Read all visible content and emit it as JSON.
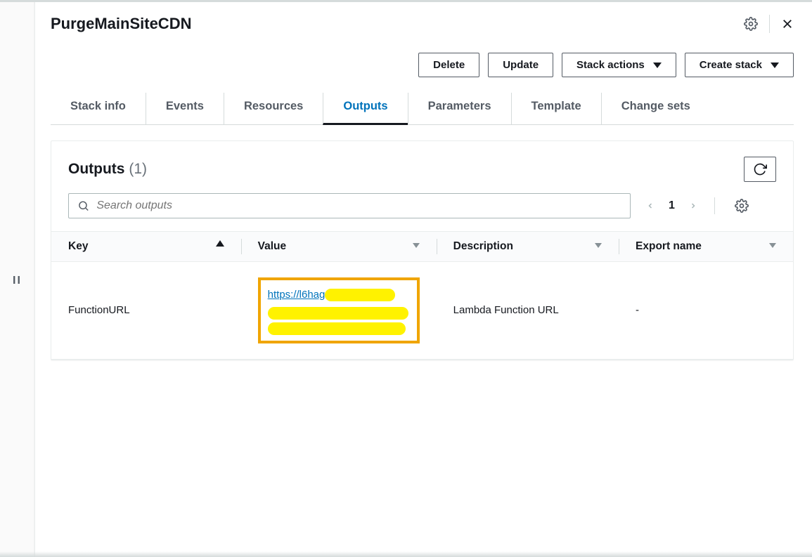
{
  "header": {
    "title": "PurgeMainSiteCDN"
  },
  "actions": {
    "delete": "Delete",
    "update": "Update",
    "stack_actions": "Stack actions",
    "create_stack": "Create stack"
  },
  "tabs": [
    {
      "label": "Stack info",
      "active": false
    },
    {
      "label": "Events",
      "active": false
    },
    {
      "label": "Resources",
      "active": false
    },
    {
      "label": "Outputs",
      "active": true
    },
    {
      "label": "Parameters",
      "active": false
    },
    {
      "label": "Template",
      "active": false
    },
    {
      "label": "Change sets",
      "active": false
    }
  ],
  "outputs": {
    "panel_title": "Outputs",
    "count_display": "(1)",
    "search_placeholder": "Search outputs",
    "page_current": "1",
    "columns": {
      "key": "Key",
      "value": "Value",
      "description": "Description",
      "export_name": "Export name"
    },
    "rows": [
      {
        "key": "FunctionURL",
        "value_link_visible": "https://l6hag",
        "description": "Lambda Function URL",
        "export_name": "-"
      }
    ]
  }
}
